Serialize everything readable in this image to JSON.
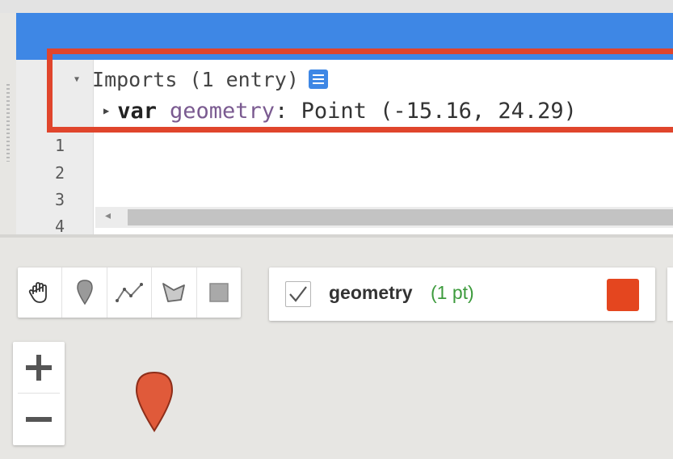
{
  "editor": {
    "imports_label": "Imports (1 entry)",
    "import_keyword": "var",
    "import_name": "geometry",
    "import_value": ": Point (-15.16, 24.29)",
    "line_numbers": [
      "1",
      "2",
      "3",
      "4"
    ]
  },
  "map": {
    "tools": [
      "pan-hand-icon",
      "point-marker-icon",
      "line-draw-icon",
      "polygon-draw-icon",
      "rectangle-draw-icon"
    ],
    "layer": {
      "name": "geometry",
      "count": "(1 pt)",
      "checked": true,
      "color": "#e4461f"
    },
    "zoom_in": "+",
    "zoom_out": "−",
    "marker_color": "#e05a3a"
  },
  "colors": {
    "highlight": "#e0452c",
    "accent": "#3e87e5"
  }
}
